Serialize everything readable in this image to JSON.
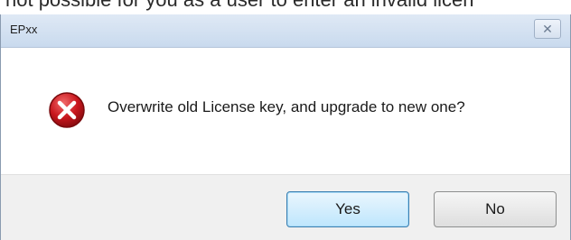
{
  "background_text": "not possible for you as a user to enter an invalid licen",
  "dialog": {
    "title": "EPxx",
    "close_icon": "✕",
    "message": "Overwrite old License key, and upgrade to new one?",
    "icon": "error-icon",
    "buttons": {
      "yes_label": "Yes",
      "no_label": "No"
    }
  },
  "colors": {
    "accent": "#3c7fb1",
    "error_red": "#c8161d"
  }
}
